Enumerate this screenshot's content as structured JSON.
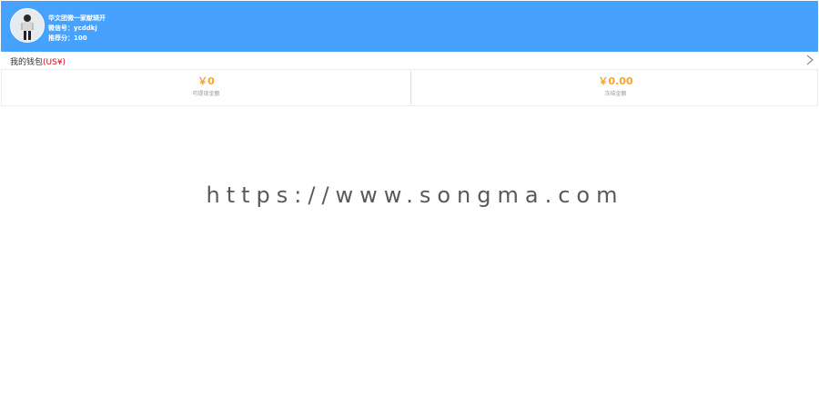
{
  "profile": {
    "name": "华文团微一家献辑开",
    "wechat_line": "微信号：ycddkj",
    "points_line": "推荐分：100"
  },
  "wallet": {
    "title": "我的钱包",
    "unit": "(US¥)"
  },
  "balances": [
    {
      "value": "￥0",
      "label": "可提现金额"
    },
    {
      "value": "￥0.00",
      "label": "冻结金额"
    }
  ],
  "watermark": "https://www.songma.com",
  "colors": {
    "header_bg": "#47a2fe",
    "amount": "#f7a42a",
    "unit_red": "#e60012"
  },
  "icons": {
    "avatar": "user-avatar-photo",
    "wallet_arrow": "chevron-right-icon"
  }
}
